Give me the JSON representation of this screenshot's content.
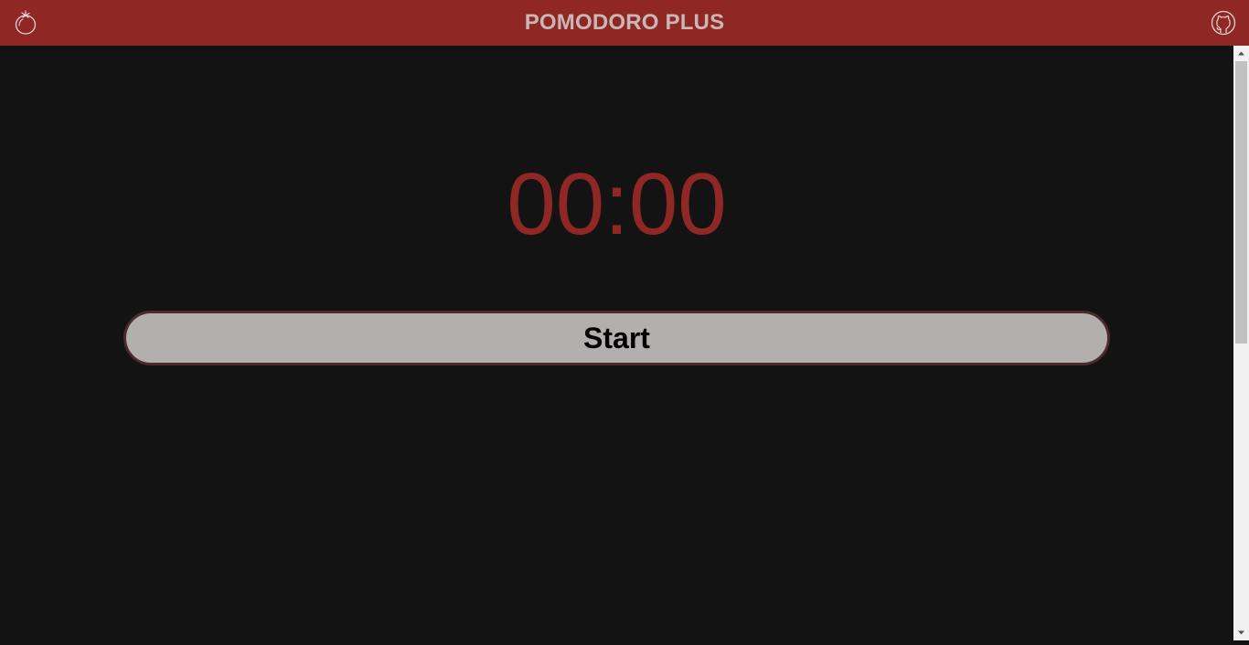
{
  "header": {
    "title": "POMODORO PLUS",
    "logo_icon": "tomato-icon",
    "github_icon": "github-icon",
    "background_color": "#8f2725",
    "title_color": "#c9b7b5"
  },
  "timer": {
    "display": "00:00",
    "color": "#8f2725"
  },
  "controls": {
    "start_label": "Start",
    "button_color": "#b3afaf"
  },
  "page": {
    "background_color": "#131313"
  }
}
